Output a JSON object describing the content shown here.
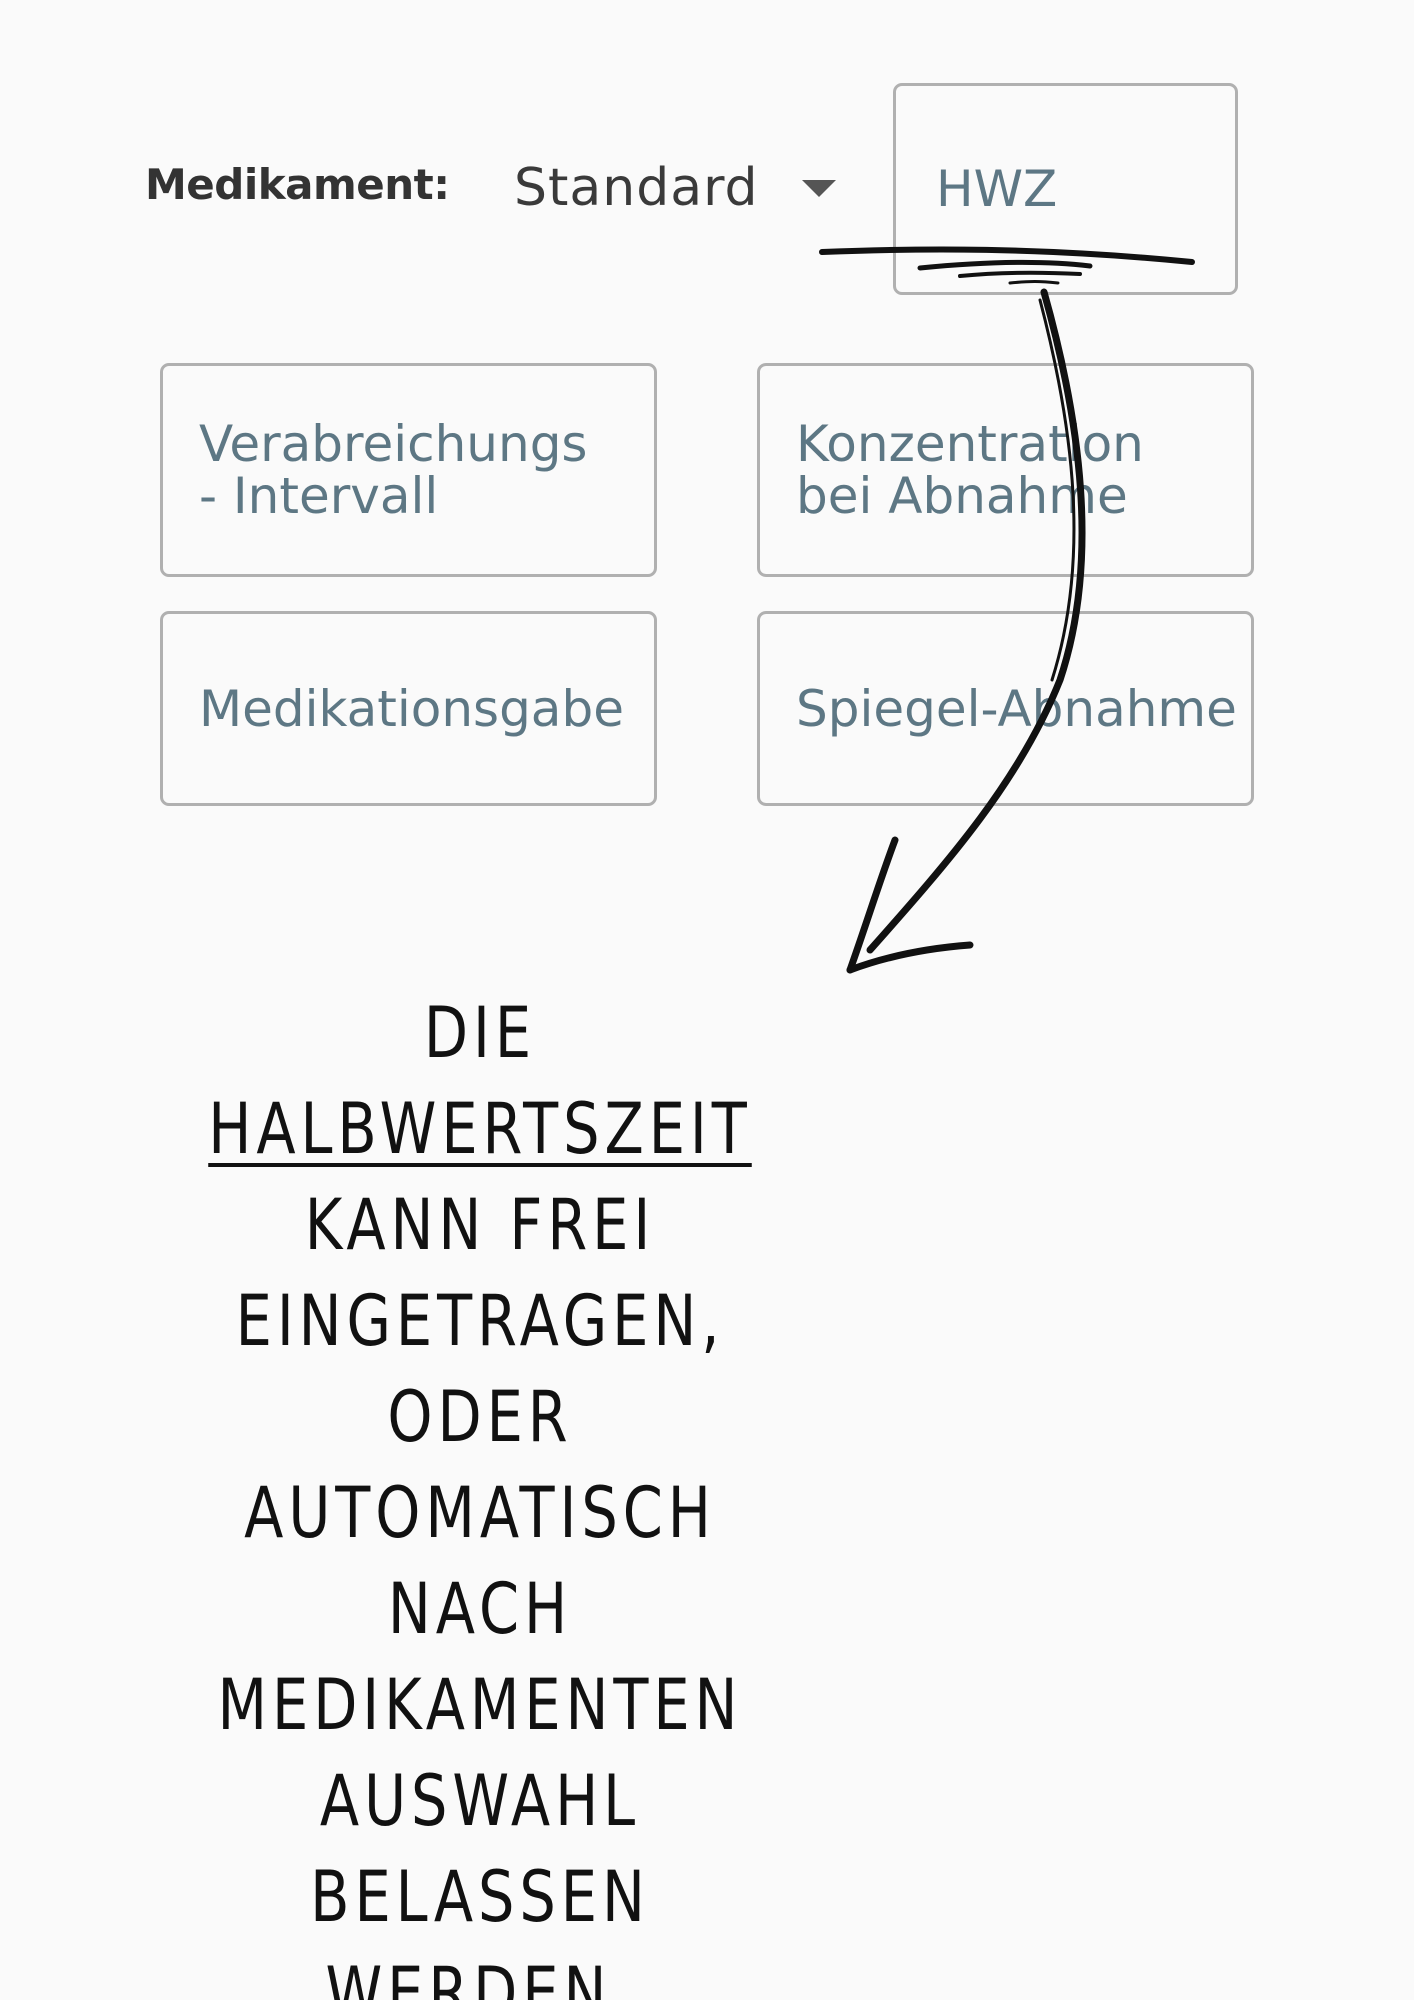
{
  "form": {
    "medikament_label": "Medikament:",
    "medikament_select": {
      "value": "Standard",
      "icon": "chevron-down-icon"
    },
    "fields": {
      "hwz": "HWZ",
      "interval": "Verabreichungs\n- Intervall",
      "konzentration": "Konzentration\nbei Abnahme",
      "medikationsgabe": "Medikationsgabe",
      "spiegel": "Spiegel-Abnahme"
    }
  },
  "annotation": {
    "prefix": "Die ",
    "highlight": "Halbwertszeit",
    "rest": "kann frei eingetragen, oder automatisch nach Medikamenten auswahl belassen werden.",
    "color": "#111111"
  }
}
